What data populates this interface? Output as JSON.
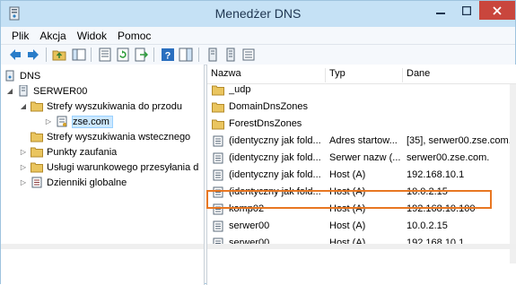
{
  "window": {
    "title": "Menedżer DNS"
  },
  "menu": [
    "Plik",
    "Akcja",
    "Widok",
    "Pomoc"
  ],
  "tree": {
    "root": "DNS",
    "server": "SERWER00",
    "forward_zones": "Strefy wyszukiwania do przodu",
    "zone": "zse.com",
    "reverse_zones": "Strefy wyszukiwania wstecznego",
    "trust_points": "Punkty zaufania",
    "conditional_forwarders": "Usługi warunkowego przesyłania d",
    "global_logs": "Dzienniki globalne"
  },
  "list": {
    "columns": [
      "Nazwa",
      "Typ",
      "Dane"
    ],
    "rows": [
      {
        "icon": "folder-icon",
        "name": "_udp",
        "type": "",
        "data": ""
      },
      {
        "icon": "folder-icon",
        "name": "DomainDnsZones",
        "type": "",
        "data": ""
      },
      {
        "icon": "folder-icon",
        "name": "ForestDnsZones",
        "type": "",
        "data": ""
      },
      {
        "icon": "record-icon",
        "name": "(identyczny jak fold...",
        "type": "Adres startow...",
        "data": "[35], serwer00.zse.com."
      },
      {
        "icon": "record-icon",
        "name": "(identyczny jak fold...",
        "type": "Serwer nazw (...",
        "data": "serwer00.zse.com."
      },
      {
        "icon": "record-icon",
        "name": "(identyczny jak fold...",
        "type": "Host (A)",
        "data": "192.168.10.1"
      },
      {
        "icon": "record-icon",
        "name": "(identyczny jak fold...",
        "type": "Host (A)",
        "data": "10.0.2.15"
      },
      {
        "icon": "record-icon",
        "name": "komp02",
        "type": "Host (A)",
        "data": "192.168.10.100"
      },
      {
        "icon": "record-icon",
        "name": "serwer00",
        "type": "Host (A)",
        "data": "10.0.2.15"
      },
      {
        "icon": "record-icon",
        "name": "serwer00",
        "type": "Host (A)",
        "data": "192.168.10.1"
      }
    ]
  },
  "colors": {
    "titlebar": "#c5e1f5",
    "close": "#c9463d",
    "highlight": "#e87722",
    "selection": "#cce8ff"
  }
}
